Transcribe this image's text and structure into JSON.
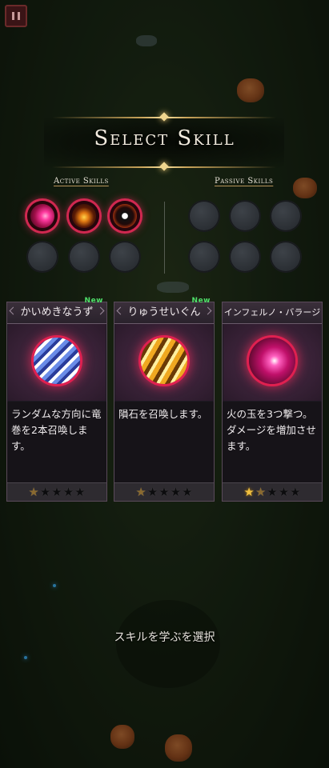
{
  "title": "Select Skill",
  "sections": {
    "active_label": "Active Skills",
    "passive_label": "Passive Skills"
  },
  "active_slots": [
    {
      "icon": "pink-fireball-icon",
      "filled": true
    },
    {
      "icon": "flame-vortex-icon",
      "filled": true
    },
    {
      "icon": "bomb-icon",
      "filled": true
    },
    {
      "icon": "empty-slot",
      "filled": false
    },
    {
      "icon": "empty-slot",
      "filled": false
    },
    {
      "icon": "empty-slot",
      "filled": false
    }
  ],
  "passive_slots": [
    {
      "icon": "empty-slot",
      "filled": false
    },
    {
      "icon": "empty-slot",
      "filled": false
    },
    {
      "icon": "empty-slot",
      "filled": false
    },
    {
      "icon": "empty-slot",
      "filled": false
    },
    {
      "icon": "empty-slot",
      "filled": false
    },
    {
      "icon": "empty-slot",
      "filled": false
    }
  ],
  "cards": [
    {
      "name": "かいめきなうず",
      "new_tag": "New",
      "icon": "tornado-orb-icon",
      "description": "ランダムな方向に竜巻を2本召喚します。",
      "stars_filled": 0,
      "stars_half": 1,
      "stars_total": 5
    },
    {
      "name": "りゅうせいぐん",
      "new_tag": "New",
      "icon": "meteor-orb-icon",
      "description": "隕石を召喚します。",
      "stars_filled": 0,
      "stars_half": 1,
      "stars_total": 5
    },
    {
      "name": "インフェルノ・バラージ",
      "new_tag": "",
      "icon": "inferno-barrage-orb-icon",
      "description": "火の玉を3つ撃つ。ダメージを増加させます。",
      "stars_filled": 1,
      "stars_half": 1,
      "stars_total": 5
    }
  ],
  "prompt": "スキルを学ぶを選択",
  "colors": {
    "accent_gold": "#c9a45a",
    "slot_glow": "#d02850",
    "new_tag": "#4fe06a",
    "star_lit": "#f0c040"
  }
}
